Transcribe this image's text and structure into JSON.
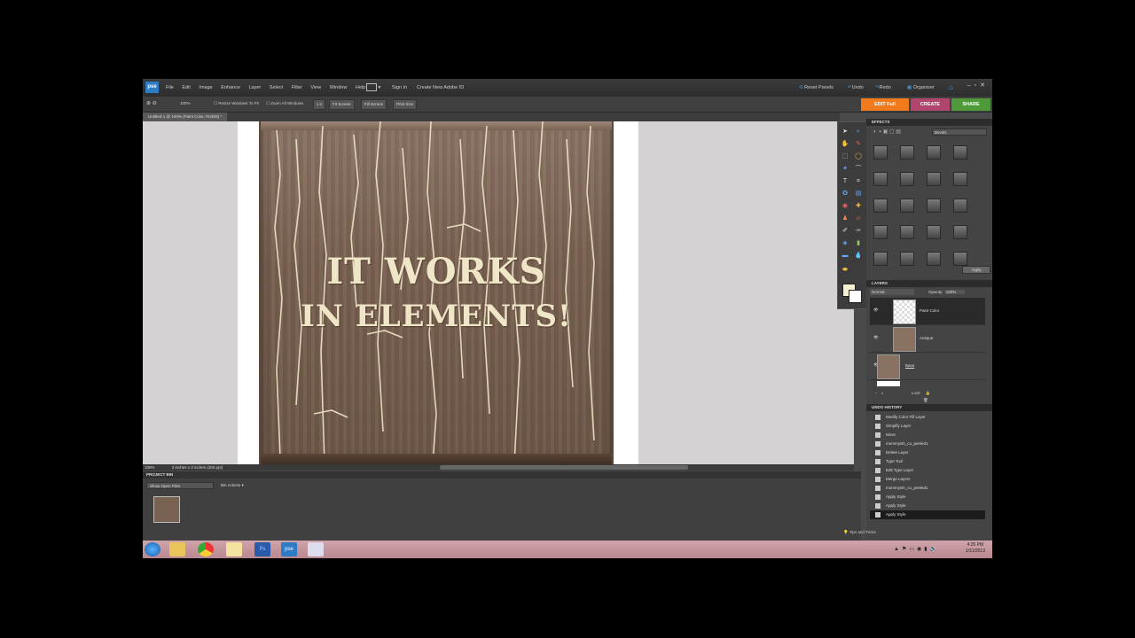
{
  "app": {
    "logo": "pse"
  },
  "menu": [
    "File",
    "Edit",
    "Image",
    "Enhance",
    "Layer",
    "Select",
    "Filter",
    "View",
    "Window",
    "Help"
  ],
  "signin": "Sign In",
  "create_id": "Create New Adobe ID",
  "right_tools": {
    "reset": "Reset Panels",
    "undo": "Undo",
    "redo": "Redo",
    "organizer": "Organizer"
  },
  "options": {
    "zoom": "100%",
    "resize": "Resize Windows To Fit",
    "zoom_all": "Zoom All Windows",
    "one_to_one": "1:1",
    "fit": "Fit Screen",
    "fill": "Fill Screen",
    "print": "Print Size"
  },
  "modes": {
    "edit": "EDIT Full",
    "create": "CREATE",
    "share": "SHARE"
  },
  "doc_tab": "Untitled-1 @ 100% (Paint Color, RGB/8) *",
  "canvas_text": {
    "line1": "IT WORKS",
    "line2": "IN ELEMENTS!"
  },
  "status": {
    "zoom": "100%",
    "size": "3 inches x 3 inches (300 ppi)"
  },
  "project_bin": {
    "title": "PROJECT BIN",
    "show": "Show Open Files",
    "actions": "Bin Actions"
  },
  "effects": {
    "title": "EFFECTS",
    "category": "Bevels",
    "apply": "Apply"
  },
  "layers": {
    "title": "LAYERS",
    "mode": "Normal",
    "opacity_label": "Opacity:",
    "opacity": "100%",
    "lock": "Lock:",
    "items": [
      {
        "name": "Paint Color"
      },
      {
        "name": "Antique"
      },
      {
        "name": "Base"
      }
    ]
  },
  "history": {
    "title": "UNDO HISTORY",
    "items": [
      "Modify Color Fill Layer",
      "Simplify Layer",
      "Move",
      "mommyish_cu_peeled1",
      "Delete Layer",
      "Type Tool",
      "Edit Type Layer",
      "Merge Layers",
      "mommyish_cu_peeled1",
      "Apply Style",
      "Apply Style",
      "Apply Style"
    ]
  },
  "tips": "Tips and Tricks",
  "clock": {
    "time": "4:25 PM",
    "date": "1/31/2013"
  },
  "colors": {
    "edit_tab": "#f07a1c",
    "create_tab": "#b0456d",
    "share_tab": "#4e9a3a"
  }
}
